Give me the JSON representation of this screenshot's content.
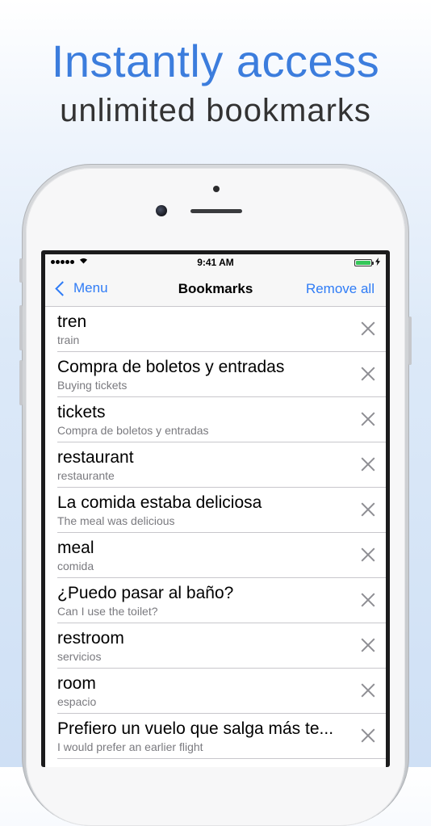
{
  "promo": {
    "headline": "Instantly access",
    "subheadline": "unlimited bookmarks"
  },
  "status_bar": {
    "time": "9:41 AM"
  },
  "nav": {
    "back_label": "Menu",
    "title": "Bookmarks",
    "action_label": "Remove all"
  },
  "bookmarks": [
    {
      "term": "tren",
      "translation": "train"
    },
    {
      "term": "Compra de boletos y entradas",
      "translation": "Buying tickets"
    },
    {
      "term": "tickets",
      "translation": "Compra de boletos y entradas"
    },
    {
      "term": "restaurant",
      "translation": "restaurante"
    },
    {
      "term": "La comida estaba deliciosa",
      "translation": "The meal was delicious"
    },
    {
      "term": "meal",
      "translation": "comida"
    },
    {
      "term": "¿Puedo pasar al baño?",
      "translation": "Can I use the toilet?"
    },
    {
      "term": "restroom",
      "translation": "servicios"
    },
    {
      "term": "room",
      "translation": "espacio"
    },
    {
      "term": "Prefiero un vuelo que salga más te...",
      "translation": "I would prefer an earlier flight"
    }
  ],
  "colors": {
    "accent": "#2f7cf6",
    "headline": "#3c7ddd",
    "battery": "#35c759"
  }
}
